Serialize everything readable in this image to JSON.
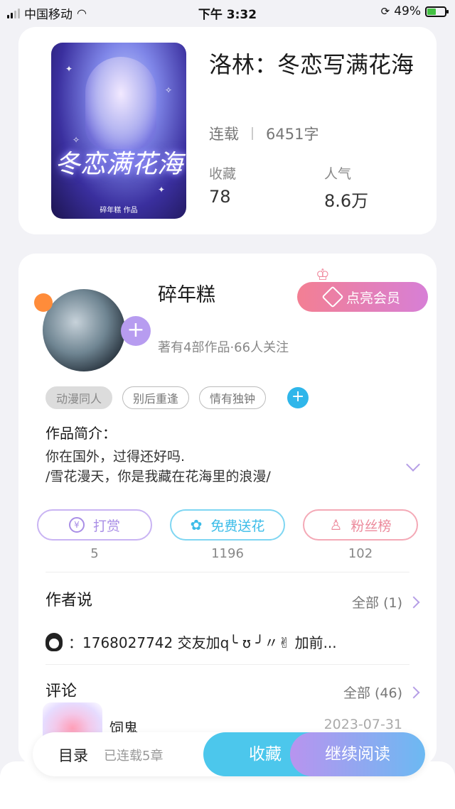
{
  "status_bar": {
    "carrier": "中国移动",
    "time": "下午 3:32",
    "battery": "49%",
    "battery_level": 0.49
  },
  "book": {
    "title": "洛林：冬恋写满花海",
    "status": "连载",
    "word_count": "6451字",
    "favorites_label": "收藏",
    "favorites_value": "78",
    "popularity_label": "人气",
    "popularity_value": "8.6万",
    "cover_title": "冬恋满花海",
    "cover_subtitle": "碎年糕 作品"
  },
  "author": {
    "name": "碎年糕",
    "info": "著有4部作品·66人关注",
    "vip_label": "点亮会员"
  },
  "tags": [
    "动漫同人",
    "别后重逢",
    "情有独钟"
  ],
  "intro": {
    "label": "作品简介：",
    "line1": "你在国外，过得还好吗.",
    "line2": "/雪花漫天，你是我藏在花海里的浪漫/"
  },
  "actions": [
    {
      "label": "打赏",
      "count": "5",
      "icon": "yen-icon",
      "color": "#b79cf0"
    },
    {
      "label": "免费送花",
      "count": "1196",
      "icon": "flower-icon",
      "color": "#4cc7ec"
    },
    {
      "label": "粉丝榜",
      "count": "102",
      "icon": "fans-icon",
      "color": "#f08a9e"
    }
  ],
  "author_says": {
    "title": "作者说",
    "more": "全部 (1)",
    "content": "：1768027742 交友加q╰ ʊ ╯〃✌ 加前..."
  },
  "comments": {
    "title": "评论",
    "more": "全部 (46)",
    "first_user": "饲鬼",
    "first_date": "2023-07-31"
  },
  "bottom_bar": {
    "toc": "目录",
    "toc_info": "已连载5章",
    "favorite": "收藏",
    "continue_read": "继续阅读"
  }
}
